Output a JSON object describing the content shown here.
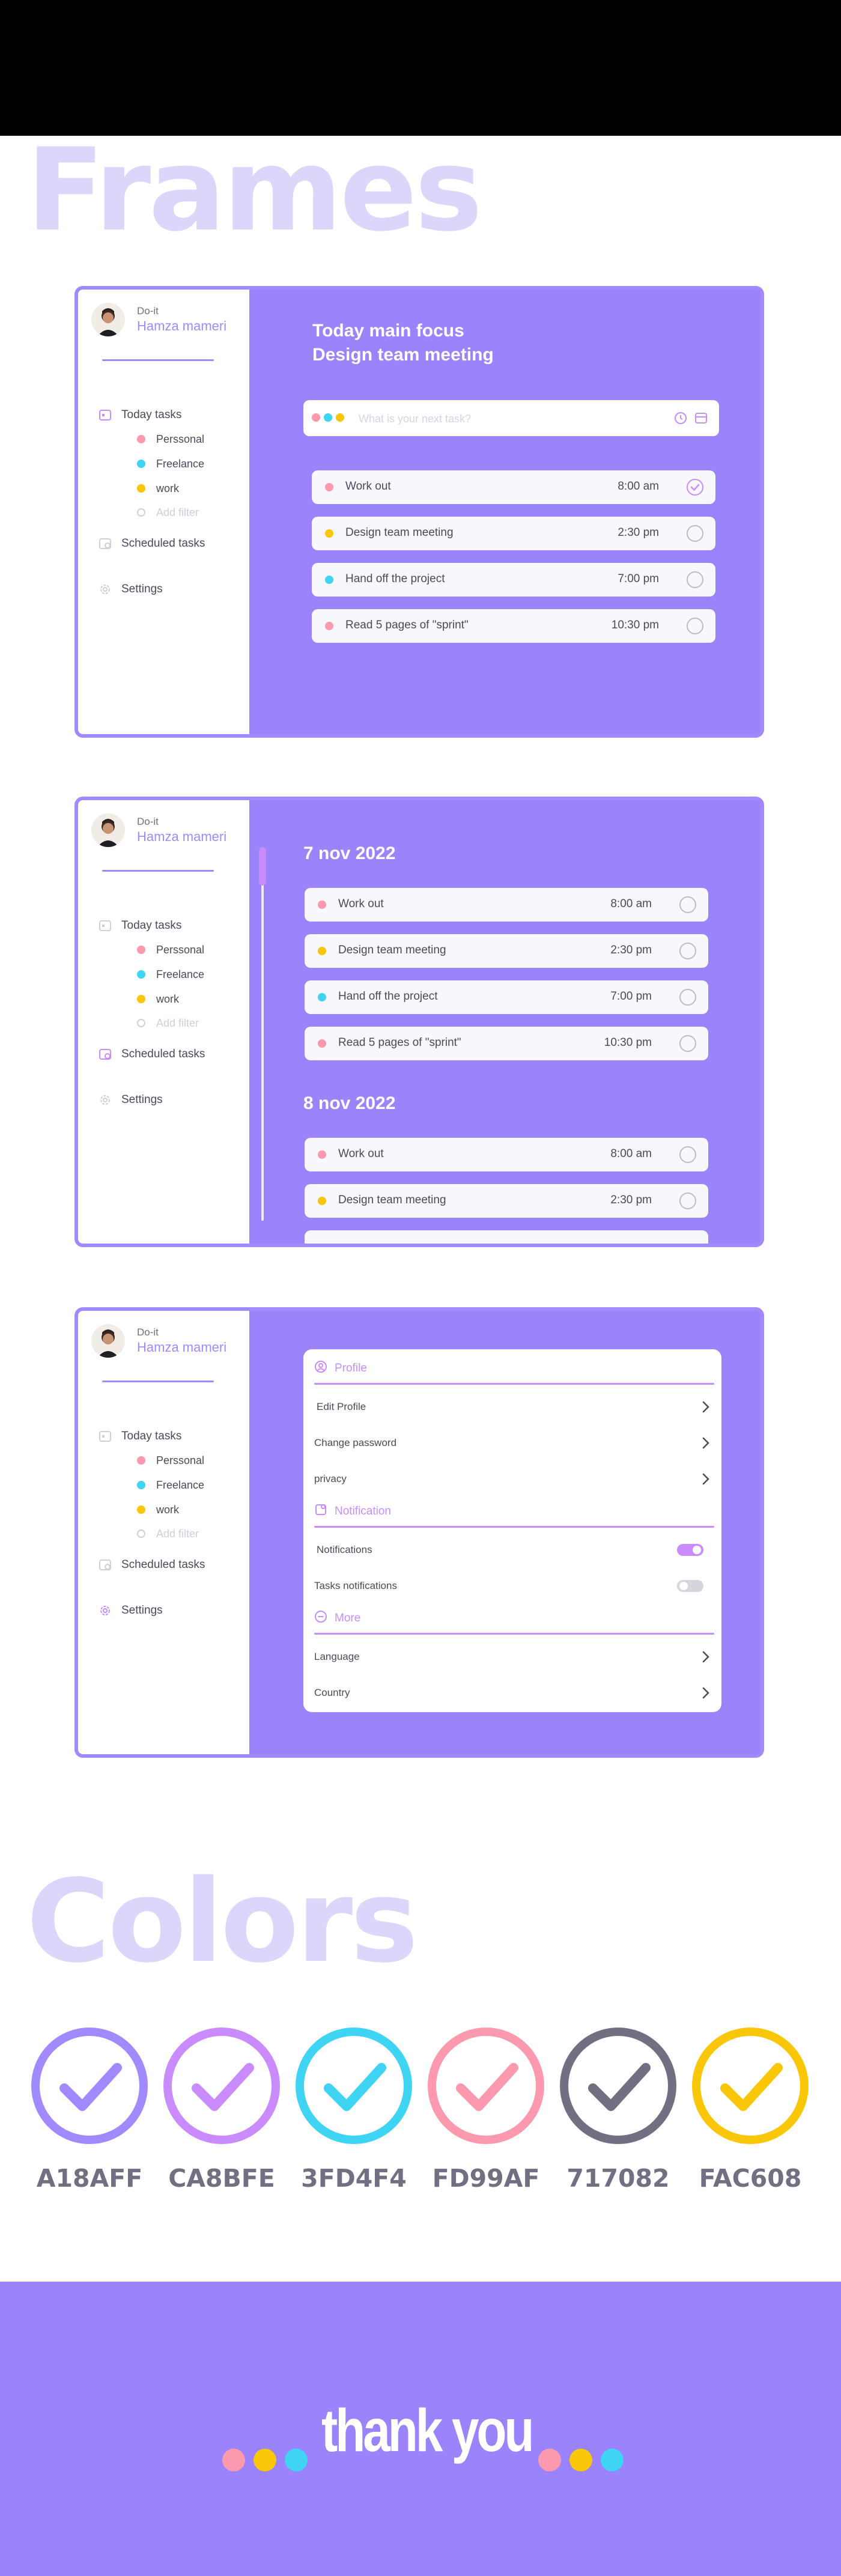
{
  "colors": {
    "primary": "#A18AFF",
    "frame_bg": "#9A83FB",
    "accent": "#CA8BFE",
    "cyan": "#3FD4F4",
    "pink": "#FD99AF",
    "gray": "#717082",
    "yellow": "#FAC608",
    "heading": "#DDD6FB"
  },
  "headings": {
    "frames": "Frames",
    "colors": "Colors"
  },
  "app": {
    "name": "Do-it",
    "user": "Hamza mameri"
  },
  "nav": {
    "today": "Today tasks",
    "scheduled": "Scheduled tasks",
    "settings": "Settings",
    "filters": [
      {
        "label": "Perssonal",
        "color": "#FD99AF"
      },
      {
        "label": "Freelance",
        "color": "#3FD4F4"
      },
      {
        "label": "work",
        "color": "#FAC608"
      }
    ],
    "add_filter": "Add filter"
  },
  "today_screen": {
    "focus_label": "Today main focus",
    "focus_task": "Design team meeting",
    "search_placeholder": "What is your next task?",
    "tasks": [
      {
        "label": "Work out",
        "time": "8:00 am",
        "color": "#FD99AF",
        "done": true
      },
      {
        "label": "Design team meeting",
        "time": "2:30 pm",
        "color": "#FAC608",
        "done": false
      },
      {
        "label": "Hand off the project",
        "time": "7:00 pm",
        "color": "#3FD4F4",
        "done": false
      },
      {
        "label": "Read 5 pages of \"sprint\"",
        "time": "10:30 pm",
        "color": "#FD99AF",
        "done": false
      }
    ]
  },
  "scheduled_screen": {
    "days": [
      {
        "date": "7 nov 2022",
        "tasks": [
          {
            "label": "Work out",
            "time": "8:00 am",
            "color": "#FD99AF"
          },
          {
            "label": "Design team meeting",
            "time": "2:30 pm",
            "color": "#FAC608"
          },
          {
            "label": "Hand off the project",
            "time": "7:00 pm",
            "color": "#3FD4F4"
          },
          {
            "label": "Read 5 pages of \"sprint\"",
            "time": "10:30 pm",
            "color": "#FD99AF"
          }
        ]
      },
      {
        "date": "8 nov 2022",
        "tasks": [
          {
            "label": "Work out",
            "time": "8:00 am",
            "color": "#FD99AF"
          },
          {
            "label": "Design team meeting",
            "time": "2:30 pm",
            "color": "#FAC608"
          }
        ]
      }
    ]
  },
  "settings_screen": {
    "profile": "Profile",
    "edit_profile": "Edit Profile",
    "change_password": "Change password",
    "privacy": "privacy",
    "notification": "Notification",
    "notifications": "Notifications",
    "notifications_on": true,
    "tasks_notifications": "Tasks notifications",
    "tasks_notifications_on": false,
    "more": "More",
    "language": "Language",
    "country": "Country"
  },
  "swatches": [
    {
      "hex": "#A18AFF",
      "label": "A18AFF"
    },
    {
      "hex": "#CA8BFE",
      "label": "CA8BFE"
    },
    {
      "hex": "#3FD4F4",
      "label": "3FD4F4"
    },
    {
      "hex": "#FD99AF",
      "label": "FD99AF"
    },
    {
      "hex": "#717082",
      "label": "717082"
    },
    {
      "hex": "#FAC608",
      "label": "FAC608"
    }
  ],
  "footer": {
    "text": "thank you",
    "left_dots": [
      "#FD99AF",
      "#FAC608",
      "#3FD4F4"
    ],
    "right_dots": [
      "#FD99AF",
      "#FAC608",
      "#3FD4F4"
    ]
  }
}
